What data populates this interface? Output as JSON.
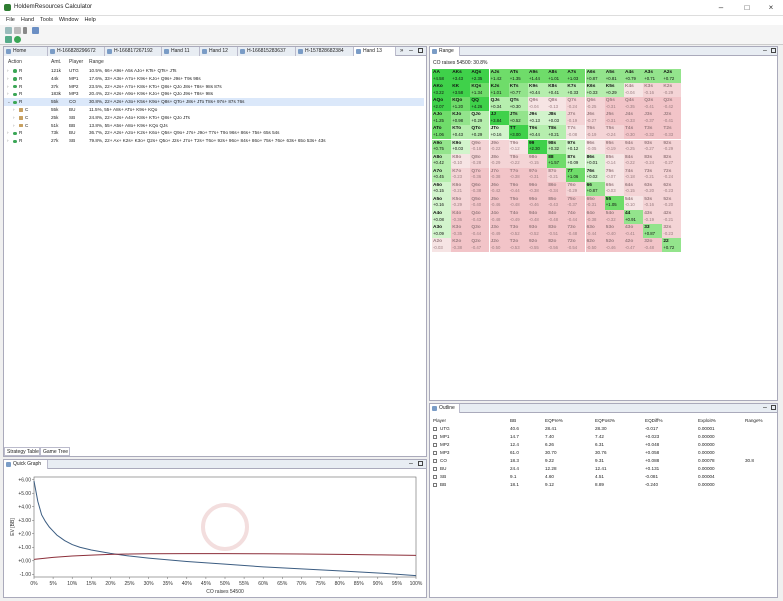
{
  "app": {
    "title": "HoldemResources Calculator",
    "menu": [
      "File",
      "Hand",
      "Tools",
      "Window",
      "Help"
    ]
  },
  "tabs": [
    "Home",
    "H-166828296672",
    "H-166817267192",
    "Hand 11",
    "Hand 12",
    "H-166815283637",
    "H-157828682384",
    "Hand 13"
  ],
  "strategy": {
    "headers": [
      "Action",
      "Amt.",
      "Player",
      "Range"
    ],
    "rows": [
      {
        "indent": 0,
        "action": "R",
        "amt": "121k",
        "player": "UTG",
        "range": "10.5%, 66+ A9s+ A5s AJo+ KTs+ QTs+ JTs",
        "sel": false,
        "dot": true
      },
      {
        "indent": 0,
        "action": "R",
        "amt": "44k",
        "player": "MP1",
        "range": "17.6%, 33+ A3s+ A7o+ K9s+ KJo+ Q9s+ J9s+ T9s 98s",
        "sel": false,
        "dot": true
      },
      {
        "indent": 0,
        "action": "R",
        "amt": "37k",
        "player": "MP2",
        "range": "23.5%, 22+ A2s+ A7o+ K8s+ KTo+ Q8s+ QJo J8s+ T8s+ 98s 87s",
        "sel": false,
        "dot": true
      },
      {
        "indent": 0,
        "action": "R",
        "amt": "183k",
        "player": "MP3",
        "range": "20.4%, 22+ A2s+ A9o+ K9s+ KJo+ Q9s+ QJo J9s+ T8s+ 98s",
        "sel": false,
        "dot": true
      },
      {
        "indent": 0,
        "action": "R",
        "amt": "55k",
        "player": "CO",
        "range": "30.8%, 22+ A2s+ A3o+ K5s+ K9o+ Q8s+ QTo+ J8s+ JTo T8s+ 97s+ 87s 76s",
        "sel": true,
        "dot": true
      },
      {
        "indent": 1,
        "action": "C",
        "amt": "55k",
        "player": "BU",
        "range": "11.5%, 55+ A8s+ ATo+ K9s+ KQo",
        "sel": false,
        "dot": false
      },
      {
        "indent": 1,
        "action": "C",
        "amt": "25k",
        "player": "SB",
        "range": "24.8%, 22+ A2s+ A4o+ K8s+ KTo+ Q8s+ QJo JTs",
        "sel": false,
        "dot": false
      },
      {
        "indent": 1,
        "action": "C",
        "amt": "51k",
        "player": "BB",
        "range": "13.8%, 55+ A5s+ A8o+ K9s+ KQo QJs",
        "sel": false,
        "dot": false
      },
      {
        "indent": 0,
        "action": "R",
        "amt": "73k",
        "player": "BU",
        "range": "36.7%, 22+ A2s+ A2o+ K2s+ K6o+ Q5s+ Q9o+ J7s+ J9o+ T7s+ T9o 96s+ 86s+ 75s+ 65s 54s",
        "sel": false,
        "dot": true
      },
      {
        "indent": 0,
        "action": "R",
        "amt": "27k",
        "player": "SB",
        "range": "79.8%, 22+ Ax+ K2s+ K3o+ Q2s+ Q5o+ J2s+ J7o+ T2s+ T6o+ 92s+ 96o+ 84s+ 86o+ 75s+ 76o+ 63s+ 65o 53s+ 43s",
        "sel": false,
        "dot": true
      }
    ]
  },
  "bottom_tabs": [
    "Strategy Table",
    "Game Tree"
  ],
  "range": {
    "panel_title": "Range",
    "heading": "CO raises 54500: 30.8%",
    "cells": [
      [
        "AA",
        "+4.58",
        "AKs",
        "+3.43",
        "AQs",
        "+2.35",
        "AJs",
        "+1.42",
        "ATs",
        "+1.35",
        "A9s",
        "+1.44",
        "A8s",
        "+1.01",
        "A7s",
        "+1.03",
        "A6s",
        "+0.87",
        "A5s",
        "+0.81",
        "A4s",
        "+0.79",
        "A3s",
        "+0.71",
        "A2s",
        "+0.72"
      ],
      [
        "AKo",
        "+3.22",
        "KK",
        "+3.58",
        "KQs",
        "+1.34",
        "KJs",
        "+1.01",
        "KTs",
        "+0.77",
        "K9s",
        "+0.44",
        "K8s",
        "+0.41",
        "K7s",
        "+0.33",
        "K6s",
        "+0.33",
        "K5s",
        "+0.29",
        "K4s",
        "-0.04",
        "K3s",
        "-0.16",
        "K2s",
        "-0.29"
      ],
      [
        "AQo",
        "+2.07",
        "KQo",
        "+1.20",
        "QQ",
        "+4.26",
        "QJs",
        "+0.34",
        "QTs",
        "+0.30",
        "Q9s",
        "-0.04",
        "Q8s",
        "-0.13",
        "Q7s",
        "-0.24",
        "Q6s",
        "-0.25",
        "Q5s",
        "-0.31",
        "Q4s",
        "-0.35",
        "Q3s",
        "-0.41",
        "Q2s",
        "-0.42"
      ],
      [
        "AJo",
        "+1.25",
        "KJo",
        "+0.98",
        "QJo",
        "+0.29",
        "JJ",
        "+3.84",
        "JTs",
        "+0.52",
        "J9s",
        "+0.13",
        "J8s",
        "+0.03",
        "J7s",
        "-0.19",
        "J6s",
        "-0.27",
        "J5s",
        "-0.31",
        "J4s",
        "-0.33",
        "J3s",
        "-0.37",
        "J2s",
        "-0.41"
      ],
      [
        "ATo",
        "+1.06",
        "KTo",
        "+0.43",
        "QTo",
        "+0.29",
        "JTo",
        "+0.16",
        "TT",
        "+3.00",
        "T9s",
        "+0.44",
        "T8s",
        "+0.21",
        "T7s",
        "-0.08",
        "T6s",
        "-0.19",
        "T5s",
        "-0.24",
        "T4s",
        "-0.30",
        "T3s",
        "-0.32",
        "T2s",
        "-0.33"
      ],
      [
        "A9o",
        "+0.75",
        "K9o",
        "+0.03",
        "Q9o",
        "-0.18",
        "J9o",
        "-0.22",
        "T9o",
        "-0.12",
        "99",
        "+2.30",
        "98s",
        "+0.32",
        "97s",
        "+0.12",
        "96s",
        "-0.05",
        "95s",
        "-0.19",
        "94s",
        "-0.25",
        "93s",
        "-0.27",
        "92s",
        "-0.29"
      ],
      [
        "A8o",
        "+0.42",
        "K8o",
        "-0.10",
        "Q8o",
        "-0.28",
        "J8o",
        "-0.29",
        "T8o",
        "-0.22",
        "98o",
        "-0.15",
        "88",
        "+1.57",
        "87s",
        "+0.09",
        "86s",
        "+0.01",
        "85s",
        "-0.14",
        "84s",
        "-0.22",
        "83s",
        "-0.24",
        "82s",
        "-0.27"
      ],
      [
        "A7o",
        "+0.45",
        "K7o",
        "-0.23",
        "Q7o",
        "-0.36",
        "J7o",
        "-0.38",
        "T7o",
        "-0.38",
        "97o",
        "-0.31",
        "87o",
        "-0.21",
        "77",
        "+1.06",
        "76s",
        "+0.02",
        "75s",
        "-0.07",
        "74s",
        "-0.18",
        "73s",
        "-0.21",
        "72s",
        "-0.24"
      ],
      [
        "A6o",
        "+0.15",
        "K6o",
        "-0.21",
        "Q6o",
        "-0.38",
        "J6o",
        "-0.42",
        "T6o",
        "-0.44",
        "96o",
        "-0.38",
        "86o",
        "-0.34",
        "76o",
        "-0.29",
        "66",
        "+0.87",
        "65s",
        "-0.03",
        "64s",
        "-0.15",
        "63s",
        "-0.20",
        "62s",
        "-0.23"
      ],
      [
        "A5o",
        "+0.16",
        "K5o",
        "-0.29",
        "Q5o",
        "-0.40",
        "J5o",
        "-0.46",
        "T5o",
        "-0.48",
        "95o",
        "-0.46",
        "85o",
        "-0.43",
        "75o",
        "-0.37",
        "65o",
        "-0.31",
        "55",
        "+1.05",
        "54s",
        "-0.10",
        "53s",
        "-0.16",
        "52s",
        "-0.20"
      ],
      [
        "A4o",
        "+0.08",
        "K4o",
        "-0.36",
        "Q4o",
        "-0.43",
        "J4o",
        "-0.48",
        "T4o",
        "-0.49",
        "94o",
        "-0.48",
        "84o",
        "-0.48",
        "74o",
        "-0.44",
        "64o",
        "-0.38",
        "54o",
        "-0.32",
        "44",
        "+0.91",
        "43s",
        "-0.19",
        "42s",
        "-0.21"
      ],
      [
        "A3o",
        "+0.09",
        "K3o",
        "-0.35",
        "Q3o",
        "-0.44",
        "J3o",
        "-0.49",
        "T3o",
        "-0.52",
        "93o",
        "-0.52",
        "83o",
        "-0.51",
        "73o",
        "-0.48",
        "63o",
        "-0.44",
        "53o",
        "-0.40",
        "43o",
        "-0.41",
        "33",
        "+0.87",
        "32s",
        "-0.23"
      ],
      [
        "A2o",
        "-0.03",
        "K2o",
        "-0.38",
        "Q2o",
        "-0.47",
        "J2o",
        "-0.50",
        "T2o",
        "-0.53",
        "92o",
        "-0.55",
        "82o",
        "-0.56",
        "72o",
        "-0.54",
        "62o",
        "-0.50",
        "52o",
        "-0.46",
        "42o",
        "-0.47",
        "32o",
        "-0.48",
        "22",
        "+0.72"
      ]
    ]
  },
  "outline": {
    "panel_title": "Outline",
    "headers": [
      "Player",
      "BB",
      "EQPre%",
      "EQPost%",
      "EQDiff%",
      "Exploit%",
      "Range%"
    ],
    "rows": [
      [
        "UTG",
        "40.6",
        "28.41",
        "28.30",
        "-0.017",
        "0.00001",
        ""
      ],
      [
        "MP1",
        "14.7",
        "7.40",
        "7.42",
        "+0.023",
        "0.00000",
        ""
      ],
      [
        "MP2",
        "12.4",
        "6.26",
        "6.31",
        "+0.048",
        "0.00000",
        ""
      ],
      [
        "MP3",
        "61.0",
        "30.70",
        "30.76",
        "+0.058",
        "0.00000",
        ""
      ],
      [
        "CO",
        "18.3",
        "9.22",
        "9.31",
        "+0.088",
        "0.00078",
        "30.8"
      ],
      [
        "BU",
        "24.4",
        "12.28",
        "12.41",
        "+0.131",
        "0.00000",
        ""
      ],
      [
        "SB",
        "9.1",
        "4.60",
        "4.51",
        "-0.081",
        "0.00004",
        ""
      ],
      [
        "BB",
        "18.1",
        "9.12",
        "8.89",
        "-0.240",
        "0.00000",
        ""
      ]
    ]
  },
  "graph": {
    "panel_title": "Quick Graph",
    "chart_data": {
      "type": "line",
      "title": "",
      "xlabel": "CO raises 54500",
      "ylabel": "EV [BB]",
      "xlim": [
        0,
        100
      ],
      "ylim": [
        -1.2,
        6.2
      ],
      "xticks": [
        "0%",
        "5%",
        "10%",
        "15%",
        "20%",
        "25%",
        "30%",
        "35%",
        "40%",
        "45%",
        "50%",
        "55%",
        "60%",
        "65%",
        "70%",
        "75%",
        "80%",
        "85%",
        "90%",
        "95%",
        "100%"
      ],
      "yticks": [
        "+6.00",
        "+5.00",
        "+4.00",
        "+3.00",
        "+2.00",
        "+1.00",
        "+0.00",
        "-1.00"
      ],
      "series": [
        {
          "color": "#3c5d82",
          "x": [
            0,
            1,
            2,
            3,
            4,
            5,
            6,
            7,
            8,
            10,
            12,
            15,
            20,
            25,
            30,
            40,
            50,
            60,
            70,
            80,
            90,
            95,
            100
          ],
          "y": [
            5.9,
            4.4,
            3.4,
            2.9,
            2.5,
            2.2,
            1.9,
            1.7,
            1.5,
            1.2,
            1.0,
            0.8,
            0.55,
            0.35,
            0.2,
            -0.05,
            -0.25,
            -0.45,
            -0.6,
            -0.75,
            -0.9,
            -1.0,
            -1.1
          ]
        },
        {
          "color": "#8c2f3a",
          "x": [
            0,
            5,
            10,
            15,
            20,
            25,
            30,
            40,
            50,
            60,
            70,
            80,
            90,
            100
          ],
          "y": [
            0.1,
            0.25,
            0.35,
            0.42,
            0.47,
            0.5,
            0.52,
            0.53,
            0.53,
            0.52,
            0.5,
            0.47,
            0.44,
            0.4
          ]
        }
      ]
    }
  }
}
